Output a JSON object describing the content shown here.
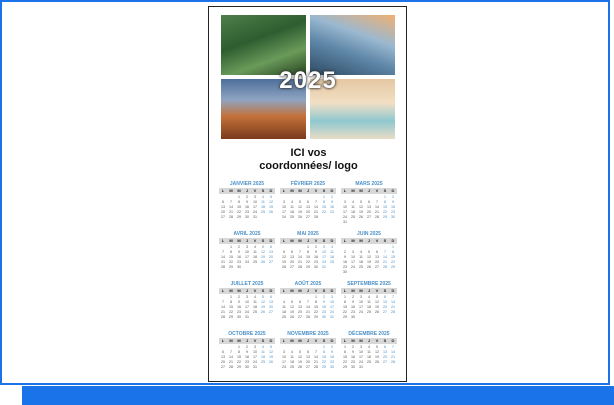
{
  "calendar": {
    "year": "2025",
    "contact_line1": "ICI vos",
    "contact_line2": "coordonnées/ logo",
    "weekday_header": [
      "L",
      "M",
      "M",
      "J",
      "V",
      "S",
      "D"
    ],
    "months": [
      {
        "name": "JANVIER 2025",
        "offset": 2,
        "days": 31
      },
      {
        "name": "FÉVRIER 2025",
        "offset": 5,
        "days": 28
      },
      {
        "name": "MARS 2025",
        "offset": 5,
        "days": 31
      },
      {
        "name": "AVRIL 2025",
        "offset": 1,
        "days": 30
      },
      {
        "name": "MAI 2025",
        "offset": 3,
        "days": 31
      },
      {
        "name": "JUIN 2025",
        "offset": 6,
        "days": 30
      },
      {
        "name": "JUILLET 2025",
        "offset": 1,
        "days": 31
      },
      {
        "name": "AOÛT 2025",
        "offset": 4,
        "days": 31
      },
      {
        "name": "SEPTEMBRE 2025",
        "offset": 0,
        "days": 30
      },
      {
        "name": "OCTOBRE 2025",
        "offset": 2,
        "days": 31
      },
      {
        "name": "NOVEMBRE 2025",
        "offset": 5,
        "days": 30
      },
      {
        "name": "DÉCEMBRE 2025",
        "offset": 0,
        "days": 31
      }
    ]
  },
  "colors": {
    "accent": "#1a73e8",
    "month_title": "#4a90c8"
  }
}
